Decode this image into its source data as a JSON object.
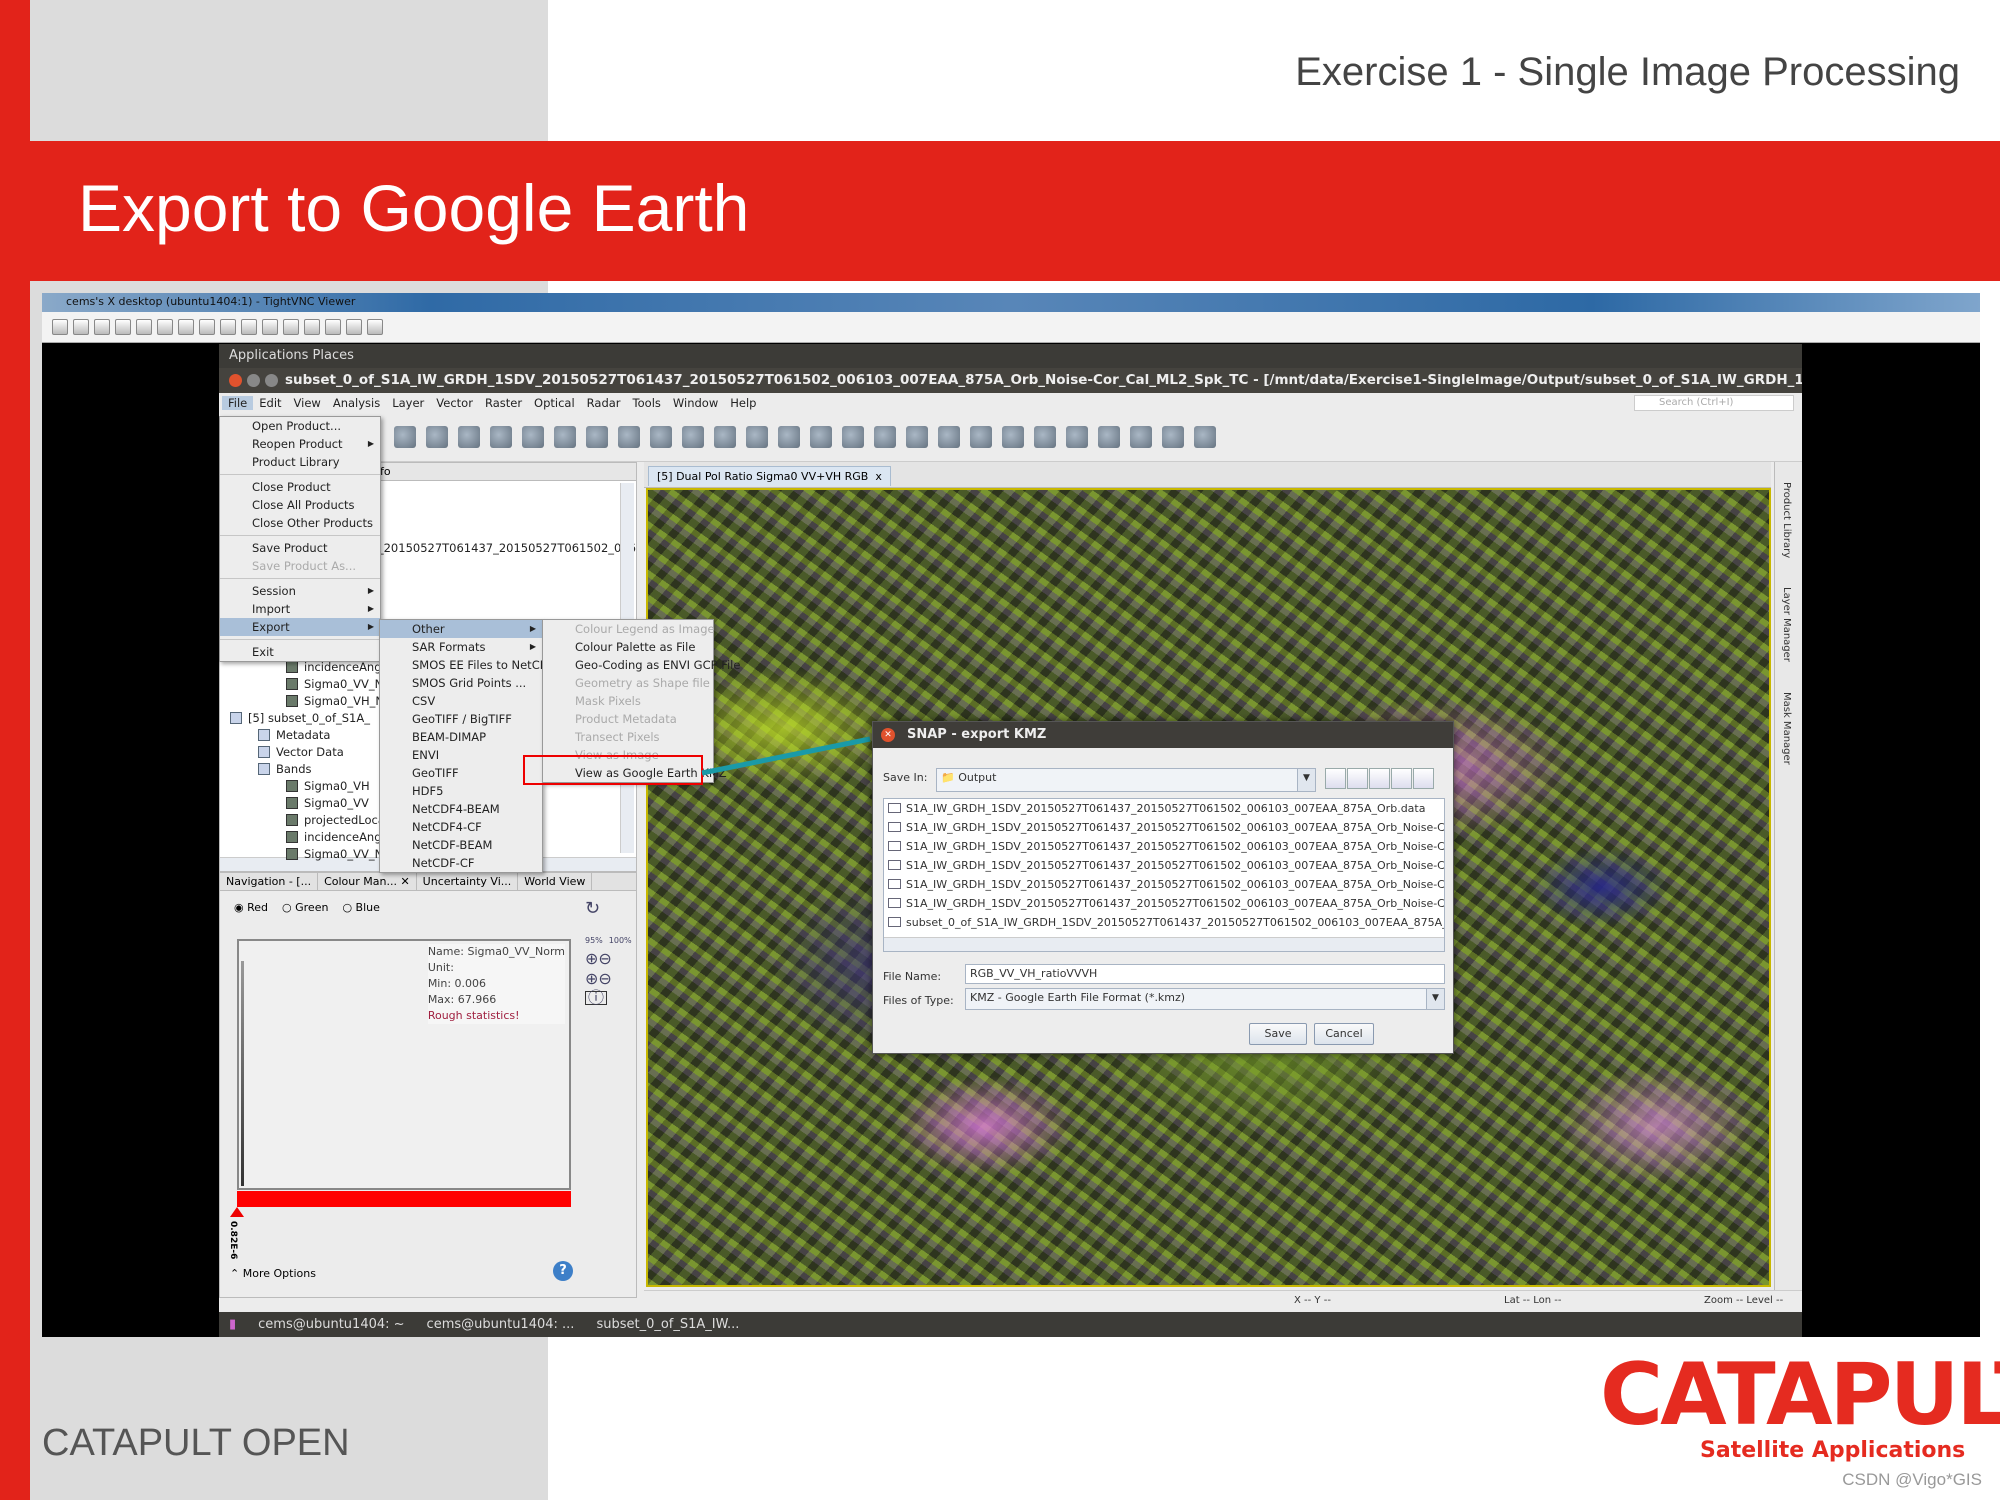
{
  "slide": {
    "header": "Exercise 1 - Single Image Processing",
    "title": "Export to Google Earth",
    "footer": "CATAPULT OPEN",
    "logo_main": "CATAPULT",
    "logo_sub": "Satellite Applications",
    "watermark": "CSDN @Vigo*GIS",
    "accent": "#e2231a"
  },
  "vnc": {
    "title": "cems's X desktop (ubuntu1404:1) - TightVNC Viewer",
    "toolbar_icons": [
      "new-connection-icon",
      "save-icon",
      "options-icon",
      "info-icon",
      "pause-icon",
      "refresh-icon",
      "ctrl-alt-del-icon",
      "file-transfer-icon",
      "ctrl-key-icon",
      "alt-key-icon",
      "clipboard-icon",
      "zoom-in-icon",
      "zoom-out-icon",
      "zoom-100-icon",
      "zoom-auto-icon",
      "fullscreen-icon"
    ]
  },
  "ubuntu": {
    "appbar": "Applications  Places",
    "window_title": "subset_0_of_S1A_IW_GRDH_1SDV_20150527T061437_20150527T061502_006103_007EAA_875A_Orb_Noise-Cor_Cal_ML2_Spk_TC - [/mnt/data/Exercise1-SingleImage/Output/subset_0_of_S1A_IW_GRDH_1SDV_20150527T06143",
    "menubar": [
      "File",
      "Edit",
      "View",
      "Analysis",
      "Layer",
      "Vector",
      "Raster",
      "Optical",
      "Radar",
      "Tools",
      "Window",
      "Help"
    ],
    "search_placeholder": "Search (Ctrl+I)",
    "toolbar_icons": [
      "graticule-icon",
      "pin-icon",
      "gcp-icon",
      "world-view-icon",
      "graph-builder-icon",
      "batch-icon",
      "select-icon",
      "pan-icon",
      "zoom-icon",
      "pin-place-icon",
      "gcp-place-icon",
      "line-icon",
      "polyline-icon",
      "rectangle-icon",
      "polygon-icon",
      "ellipse-icon",
      "range-finder-icon",
      "magic-wand-icon",
      "tile-horizontal-icon",
      "tile-vertical-icon",
      "tile-grid-icon",
      "tile-evenly-icon",
      "star-icon",
      "scatter-icon",
      "binary-icon",
      "mask-icon"
    ],
    "taskbar": [
      "cems@ubuntu1404: ~",
      "cems@ubuntu1404: ...",
      "subset_0_of_S1A_IW..."
    ],
    "status": {
      "x": "X  --  Y  --",
      "latlon": "Lat   -- Lon   --",
      "zoom": "Zoom -- Level --"
    }
  },
  "explorer": {
    "tab_partial": "fo",
    "product_line": "V_20150527T061437_20150527T061502_006",
    "tree": [
      {
        "label": "incidenceAngl",
        "type": "band",
        "indent": 2
      },
      {
        "label": "Sigma0_VV_N",
        "type": "band",
        "indent": 2
      },
      {
        "label": "Sigma0_VH_N",
        "type": "band",
        "indent": 2
      },
      {
        "label": "[5] subset_0_of_S1A_",
        "type": "product",
        "indent": 0
      },
      {
        "label": "Metadata",
        "type": "folder",
        "indent": 1
      },
      {
        "label": "Vector Data",
        "type": "folder",
        "indent": 1
      },
      {
        "label": "Bands",
        "type": "folder",
        "indent": 1
      },
      {
        "label": "Sigma0_VH",
        "type": "band",
        "indent": 2
      },
      {
        "label": "Sigma0_VV",
        "type": "band",
        "indent": 2
      },
      {
        "label": "projectedLoca",
        "type": "band",
        "indent": 2
      },
      {
        "label": "incidenceAngl",
        "type": "band",
        "indent": 2
      },
      {
        "label": "Sigma0_VV_N",
        "type": "band",
        "indent": 2
      }
    ]
  },
  "colour_manip": {
    "tabs": [
      "Navigation - [...",
      "Colour Man...  ✕",
      "Uncertainty Vi...",
      "World View"
    ],
    "channels": [
      "Red",
      "Green",
      "Blue"
    ],
    "selected": "Red",
    "stats": {
      "name": "Name: Sigma0_VV_Norm",
      "unit": "Unit:",
      "min": "Min: 0.006",
      "max": "Max: 67.966",
      "warning": "Rough statistics!"
    },
    "slider_label": "0.82E-6",
    "more_options": "More Options",
    "pct_95": "95%",
    "pct_100": "100%"
  },
  "image_view": {
    "tab": "[5] Dual Pol Ratio Sigma0 VV+VH RGB",
    "close": "x"
  },
  "right_sidebar": [
    "Product Library",
    "Layer Manager",
    "Mask Manager"
  ],
  "file_menu": [
    {
      "label": "Open Product...",
      "icon": "open-icon"
    },
    {
      "label": "Reopen Product",
      "sub": true
    },
    {
      "label": "Product Library",
      "icon": "library-icon"
    },
    {
      "sep": true
    },
    {
      "label": "Close Product"
    },
    {
      "label": "Close All Products"
    },
    {
      "label": "Close Other Products"
    },
    {
      "sep": true
    },
    {
      "label": "Save Product"
    },
    {
      "label": "Save Product As...",
      "disabled": true
    },
    {
      "sep": true
    },
    {
      "label": "Session",
      "sub": true
    },
    {
      "label": "Import",
      "sub": true
    },
    {
      "label": "Export",
      "sub": true,
      "highlight": true
    },
    {
      "sep": true
    },
    {
      "label": "Exit"
    }
  ],
  "export_menu": [
    {
      "label": "Other",
      "sub": true,
      "highlight": true
    },
    {
      "label": "SAR Formats",
      "sub": true
    },
    {
      "label": "SMOS EE Files to NetCDF..."
    },
    {
      "label": "SMOS Grid Points ..."
    },
    {
      "label": "CSV"
    },
    {
      "label": "GeoTIFF / BigTIFF"
    },
    {
      "label": "BEAM-DIMAP"
    },
    {
      "label": "ENVI"
    },
    {
      "label": "GeoTIFF"
    },
    {
      "label": "HDF5"
    },
    {
      "label": "NetCDF4-BEAM"
    },
    {
      "label": "NetCDF4-CF"
    },
    {
      "label": "NetCDF-BEAM"
    },
    {
      "label": "NetCDF-CF"
    }
  ],
  "other_menu": [
    {
      "label": "Colour Legend as Image",
      "disabled": true
    },
    {
      "label": "Colour Palette as File"
    },
    {
      "label": "Geo-Coding as ENVI GCP File"
    },
    {
      "label": "Geometry as Shape file",
      "disabled": true
    },
    {
      "label": "Mask Pixels",
      "disabled": true
    },
    {
      "label": "Product Metadata",
      "disabled": true
    },
    {
      "label": "Transect Pixels",
      "disabled": true
    },
    {
      "label": "View as Image",
      "disabled": true
    },
    {
      "label": "View as Google Earth KMZ",
      "boxed": true
    }
  ],
  "dialog": {
    "title": "SNAP - export KMZ",
    "save_in_label": "Save In:",
    "save_in": "Output",
    "files": [
      "S1A_IW_GRDH_1SDV_20150527T061437_20150527T061502_006103_007EAA_875A_Orb.data",
      "S1A_IW_GRDH_1SDV_20150527T061437_20150527T061502_006103_007EAA_875A_Orb_Noise-Cor.da",
      "S1A_IW_GRDH_1SDV_20150527T061437_20150527T061502_006103_007EAA_875A_Orb_Noise-Cor_Ca",
      "S1A_IW_GRDH_1SDV_20150527T061437_20150527T061502_006103_007EAA_875A_Orb_Noise-Cor_Ca",
      "S1A_IW_GRDH_1SDV_20150527T061437_20150527T061502_006103_007EAA_875A_Orb_Noise-Cor_Ca",
      "S1A_IW_GRDH_1SDV_20150527T061437_20150527T061502_006103_007EAA_875A_Orb_Noise-Cor_Ca",
      "subset_0_of_S1A_IW_GRDH_1SDV_20150527T061437_20150527T061502_006103_007EAA_875A_Orb_"
    ],
    "file_name_label": "File Name:",
    "file_name": "RGB_VV_VH_ratioVVVH",
    "type_label": "Files of Type:",
    "file_type": "KMZ - Google Earth File Format (*.kmz)",
    "save": "Save",
    "cancel": "Cancel",
    "nav_icons": [
      "up-folder-icon",
      "home-icon",
      "new-folder-icon",
      "list-view-icon",
      "details-view-icon"
    ]
  }
}
